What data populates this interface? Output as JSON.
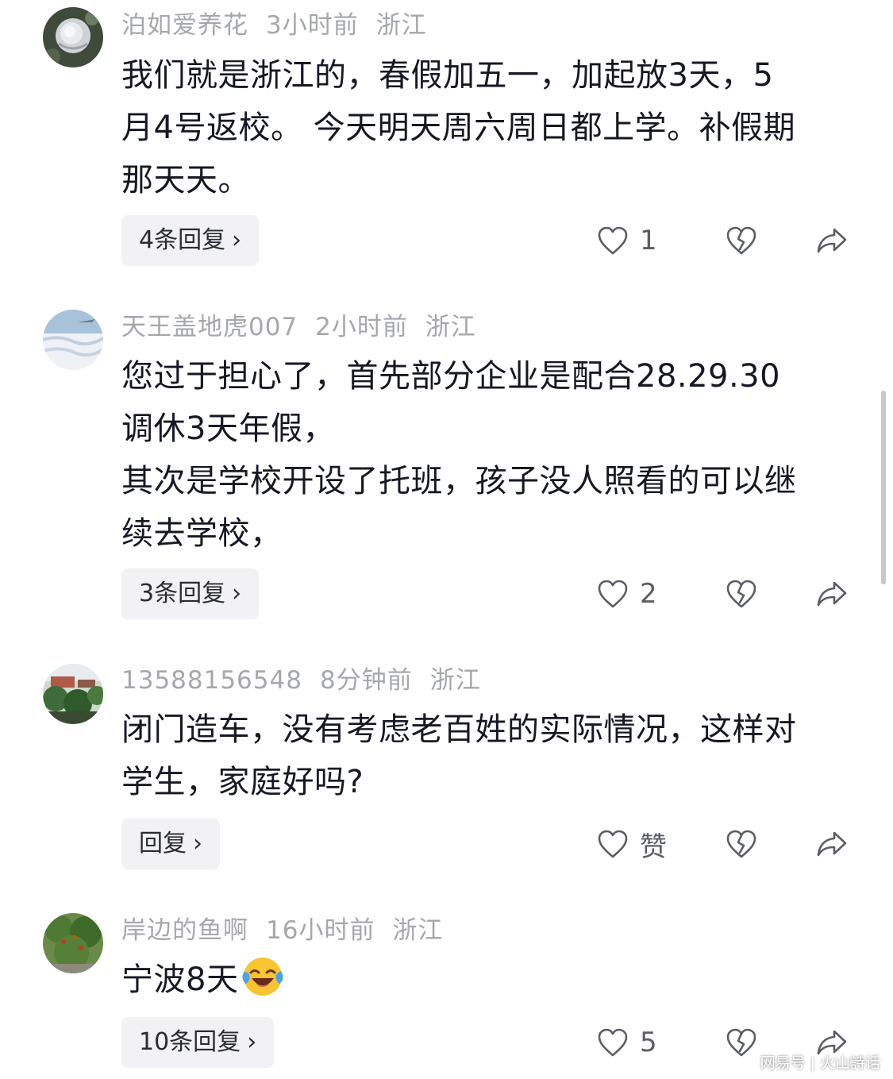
{
  "comments": [
    {
      "username": "泊如爱养花",
      "time": "3小时前",
      "location": "浙江",
      "lines": [
        "我们就是浙江的，春假加五一，加起放3天，5",
        "月4号返校。 今天明天周六周日都上学。补假期",
        "那天天。"
      ],
      "reply_label": "4条回复",
      "like_count": "1"
    },
    {
      "username": "天王盖地虎007",
      "time": "2小时前",
      "location": "浙江",
      "lines": [
        "您过于担心了，首先部分企业是配合28.29.30",
        "调休3天年假，",
        "其次是学校开设了托班，孩子没人照看的可以继",
        "续去学校，"
      ],
      "reply_label": "3条回复",
      "like_count": "2"
    },
    {
      "username": "13588156548",
      "time": "8分钟前",
      "location": "浙江",
      "lines": [
        "闭门造车，没有考虑老百姓的实际情况，这样对",
        "学生，家庭好吗?"
      ],
      "reply_label": "回复",
      "like_count": "赞"
    },
    {
      "username": "岸边的鱼啊",
      "time": "16小时前",
      "location": "浙江",
      "lines": [
        "宁波8天"
      ],
      "reply_label": "10条回复",
      "like_count": "5"
    }
  ],
  "watermark": {
    "left": "网易号",
    "right": "火山詩话"
  },
  "colors": {
    "meta_text": "#a5a7ad",
    "body_text": "#161823",
    "reply_bg": "#f2f2f4",
    "icon": "#5b5d66"
  },
  "icons": {
    "like": "heart-outline-icon",
    "dislike": "broken-heart-icon",
    "share": "share-arrow-icon",
    "chevron": "chevron-right-icon",
    "emoji": "laughing-crying-emoji"
  }
}
